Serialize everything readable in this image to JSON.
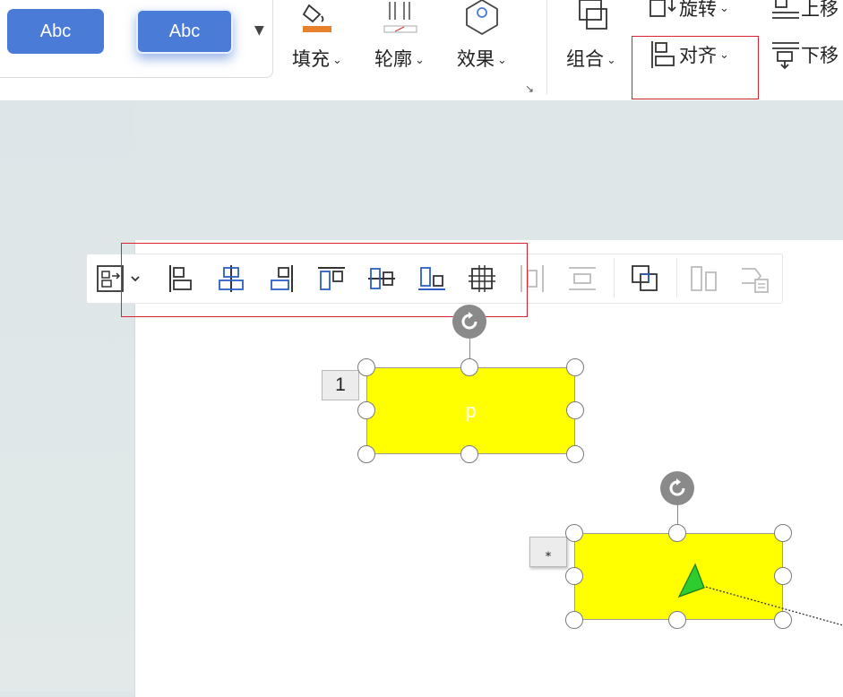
{
  "ribbon": {
    "style_preview_1": "Abc",
    "style_preview_2": "Abc",
    "fill_label": "填充",
    "outline_label": "轮廓",
    "effect_label": "效果",
    "group_label": "组合",
    "rotate_label": "旋转",
    "align_label": "对齐",
    "bring_forward_label": "上移",
    "send_backward_label": "下移",
    "fill_color": "#e8812b",
    "accent_blue": "#4a7bd6"
  },
  "alignment_toolbar": {
    "icons": [
      "distribute-menu-icon",
      "align-left-icon",
      "align-center-icon",
      "align-right-icon",
      "align-top-icon",
      "align-middle-icon",
      "align-bottom-icon",
      "align-grid-icon",
      "distribute-horizontal-icon",
      "distribute-vertical-icon",
      "group-icon",
      "ungroup-icon",
      "wrap-text-icon"
    ]
  },
  "canvas": {
    "shape_1": {
      "fill": "#ffff00",
      "text": "p",
      "tag": "1"
    },
    "shape_2": {
      "fill": "#ffff00",
      "tag": "⁎"
    },
    "highlight_color": "#d9232e"
  }
}
